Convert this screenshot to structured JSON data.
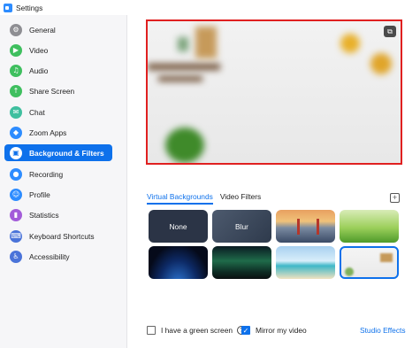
{
  "window": {
    "title": "Settings"
  },
  "sidebar": {
    "items": [
      {
        "label": "General",
        "icon": "gear-icon",
        "color": "#8e8e93",
        "glyph": "⚙",
        "active": false
      },
      {
        "label": "Video",
        "icon": "video-icon",
        "color": "#3fbf5f",
        "glyph": "▶",
        "active": false
      },
      {
        "label": "Audio",
        "icon": "headphones-icon",
        "color": "#3fbf5f",
        "glyph": "♫",
        "active": false
      },
      {
        "label": "Share Screen",
        "icon": "share-screen-icon",
        "color": "#3fbf5f",
        "glyph": "↑",
        "active": false
      },
      {
        "label": "Chat",
        "icon": "chat-icon",
        "color": "#3fbf9f",
        "glyph": "✉",
        "active": false
      },
      {
        "label": "Zoom Apps",
        "icon": "apps-icon",
        "color": "#2d8cff",
        "glyph": "◆",
        "active": false
      },
      {
        "label": "Background & Filters",
        "icon": "background-icon",
        "color": "#ffffff",
        "glyph": "▣",
        "active": true
      },
      {
        "label": "Recording",
        "icon": "record-icon",
        "color": "#2d8cff",
        "glyph": "●",
        "active": false
      },
      {
        "label": "Profile",
        "icon": "profile-icon",
        "color": "#2d8cff",
        "glyph": "☺",
        "active": false
      },
      {
        "label": "Statistics",
        "icon": "statistics-icon",
        "color": "#a35cd9",
        "glyph": "▮",
        "active": false
      },
      {
        "label": "Keyboard Shortcuts",
        "icon": "keyboard-icon",
        "color": "#4a73d9",
        "glyph": "⌨",
        "active": false
      },
      {
        "label": "Accessibility",
        "icon": "accessibility-icon",
        "color": "#4a73d9",
        "glyph": "♿",
        "active": false
      }
    ]
  },
  "main": {
    "tabs": [
      {
        "label": "Virtual Backgrounds",
        "active": true
      },
      {
        "label": "Video Filters",
        "active": false
      }
    ],
    "backgrounds": [
      {
        "label": "None",
        "style": "none"
      },
      {
        "label": "Blur",
        "style": "blur"
      },
      {
        "label": "",
        "style": "golden-gate"
      },
      {
        "label": "",
        "style": "grass"
      },
      {
        "label": "",
        "style": "earth"
      },
      {
        "label": "",
        "style": "aurora"
      },
      {
        "label": "",
        "style": "beach"
      },
      {
        "label": "",
        "style": "room"
      }
    ],
    "green_screen_label": "I have a green screen",
    "mirror_label": "Mirror my video",
    "mirror_checked": true,
    "studio_effects_label": "Studio Effects"
  },
  "colors": {
    "accent": "#0e71eb",
    "highlight_border": "#e02020"
  }
}
